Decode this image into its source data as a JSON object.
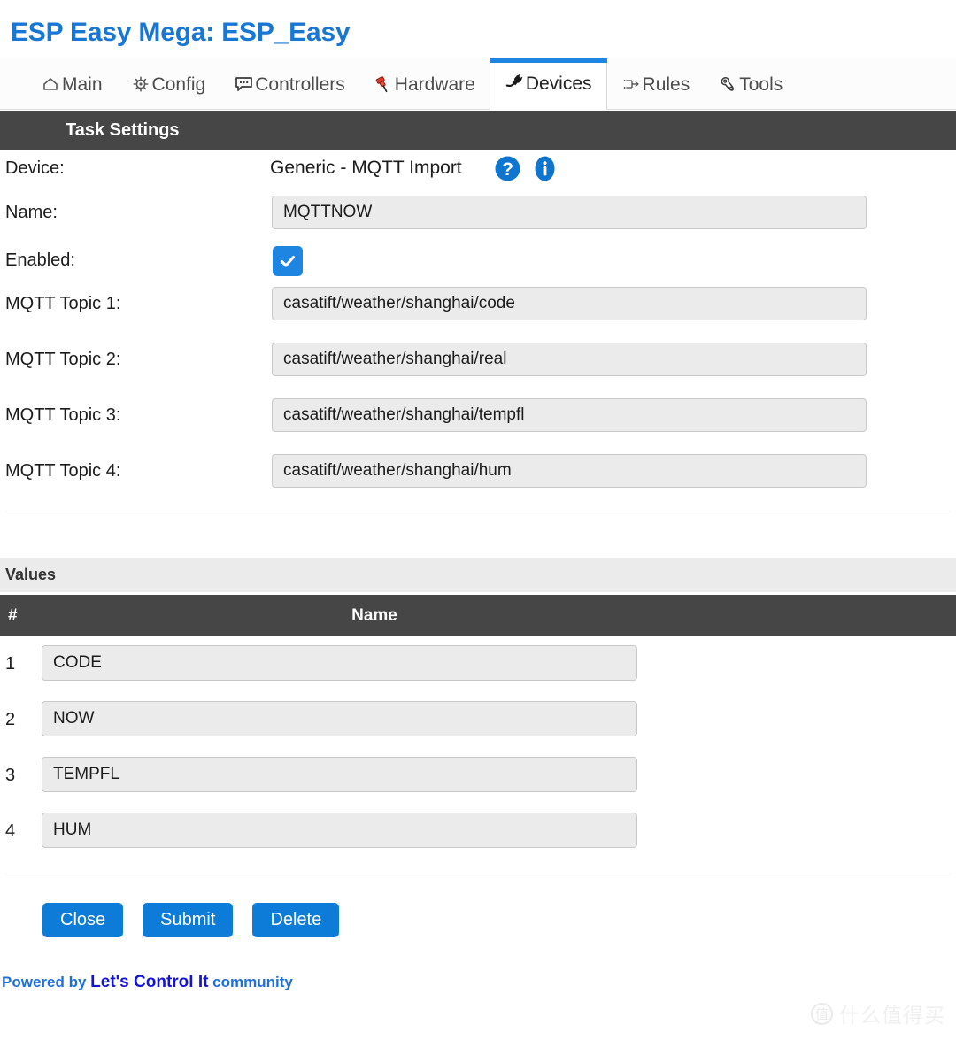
{
  "header": {
    "title": "ESP Easy Mega: ESP_Easy",
    "title_color": "#1877d4"
  },
  "nav": {
    "items": [
      {
        "label": "Main",
        "icon": "home-icon",
        "active": false
      },
      {
        "label": "Config",
        "icon": "gear-icon",
        "active": false
      },
      {
        "label": "Controllers",
        "icon": "speech-bubble-icon",
        "active": false
      },
      {
        "label": "Hardware",
        "icon": "pushpin-icon",
        "active": false
      },
      {
        "label": "Devices",
        "icon": "plug-icon",
        "active": true
      },
      {
        "label": "Rules",
        "icon": "branch-arrow-icon",
        "active": false
      },
      {
        "label": "Tools",
        "icon": "wrench-icon",
        "active": false
      }
    ],
    "active_accent": "#1e85e0"
  },
  "task_settings": {
    "section_title": "Task Settings",
    "device": {
      "label": "Device:",
      "value": "Generic - MQTT Import",
      "help_icon": "help-circle-icon",
      "info_icon": "info-circle-icon"
    },
    "name": {
      "label": "Name:",
      "value": "MQTTNOW",
      "placeholder": ""
    },
    "enabled": {
      "label": "Enabled:",
      "checked": true,
      "checkbox_color": "#1e85e0"
    },
    "topics": [
      {
        "label": "MQTT Topic 1:",
        "value": "casatift/weather/shanghai/code"
      },
      {
        "label": "MQTT Topic 2:",
        "value": "casatift/weather/shanghai/real"
      },
      {
        "label": "MQTT Topic 3:",
        "value": "casatift/weather/shanghai/tempfl"
      },
      {
        "label": "MQTT Topic 4:",
        "value": "casatift/weather/shanghai/hum"
      }
    ]
  },
  "values": {
    "section_title": "Values",
    "columns": {
      "num": "#",
      "name": "Name"
    },
    "rows": [
      {
        "num": "1",
        "name": "CODE"
      },
      {
        "num": "2",
        "name": "NOW"
      },
      {
        "num": "3",
        "name": "TEMPFL"
      },
      {
        "num": "4",
        "name": "HUM"
      }
    ]
  },
  "buttons": {
    "close": "Close",
    "submit": "Submit",
    "delete": "Delete",
    "color": "#0d7bd8"
  },
  "footer": {
    "prefix": "Powered by ",
    "brand": "Let's Control It",
    "suffix": " community"
  },
  "watermark": {
    "logo_char": "值",
    "text": "什么值得买"
  }
}
